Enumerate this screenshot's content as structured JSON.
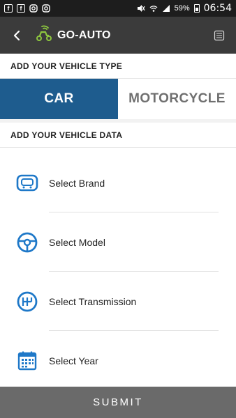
{
  "statusbar": {
    "battery_pct": "59%",
    "time": "06:54",
    "icons": [
      "facebook-icon",
      "facebook-icon",
      "instagram-icon",
      "instagram-icon",
      "mute-icon",
      "wifi-icon",
      "signal-icon",
      "battery-icon"
    ]
  },
  "appbar": {
    "app_name": "GO-AUTO",
    "icons": [
      "back-arrow-icon",
      "scooter-logo-icon",
      "list-menu-icon"
    ]
  },
  "vehicle_type": {
    "title": "ADD YOUR VEHICLE TYPE",
    "options": [
      {
        "label": "CAR",
        "selected": true
      },
      {
        "label": "MOTORCYCLE",
        "selected": false
      }
    ]
  },
  "vehicle_data": {
    "title": "ADD YOUR VEHICLE DATA",
    "items": [
      {
        "label": "Select Brand",
        "icon": "car-front-icon"
      },
      {
        "label": "Select Model",
        "icon": "steering-wheel-icon"
      },
      {
        "label": "Select Transmission",
        "icon": "gear-shift-icon"
      },
      {
        "label": "Select Year",
        "icon": "calendar-icon"
      }
    ]
  },
  "submit_label": "SUBMIT",
  "colors": {
    "accent": "#1e5c8e",
    "icon_blue": "#1e78c8",
    "appbar": "#3b3b3b",
    "submit": "#6a6a6a",
    "logo_green": "#8dc63f"
  }
}
